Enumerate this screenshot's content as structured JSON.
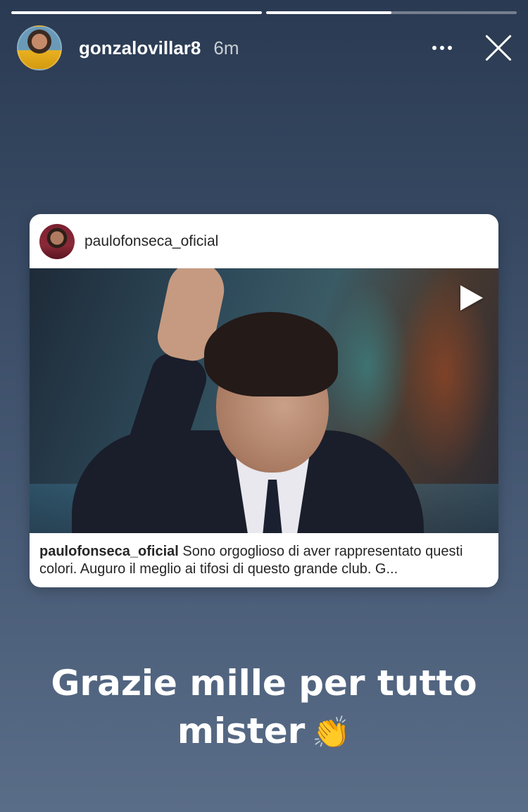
{
  "story": {
    "progress_segments": [
      {
        "fill": 1.0
      },
      {
        "fill": 0.5
      }
    ],
    "header": {
      "username": "gonzalovillar8",
      "time": "6m",
      "more_icon": "more-horizontal-icon",
      "close_icon": "close-icon"
    },
    "shared_post": {
      "username": "paulofonseca_oficial",
      "media_icon": "play-icon",
      "caption_user": "paulofonseca_oficial",
      "caption_text": " Sono orgoglioso di aver rappresentato questi colori. Auguro il meglio ai tifosi di questo grande club. G..."
    },
    "overlay_text": {
      "line1": "Grazie mille per tutto",
      "line2": "mister",
      "emoji": "👏"
    }
  }
}
